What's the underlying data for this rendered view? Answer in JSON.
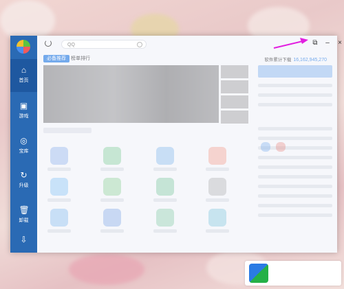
{
  "window": {
    "search_placeholder": "QQ",
    "controls": {
      "restore": "⧉",
      "minimize": "–",
      "close": "×"
    }
  },
  "sidebar": {
    "items": [
      {
        "label": "首页",
        "icon": "home-icon",
        "glyph": "⌂"
      },
      {
        "label": "游戏",
        "icon": "gamepad-icon",
        "glyph": "▣"
      },
      {
        "label": "宝库",
        "icon": "treasure-icon",
        "glyph": "◎"
      },
      {
        "label": "升级",
        "icon": "upgrade-icon",
        "glyph": "↻"
      },
      {
        "label": "卸载",
        "icon": "trash-icon",
        "glyph": "🗑"
      },
      {
        "label": "",
        "icon": "download-icon",
        "glyph": "⇩"
      }
    ]
  },
  "tabs": {
    "active": "必备推荐",
    "second": "榜单排行"
  },
  "stats": {
    "label": "软件累计下载",
    "value": "16,162,945,270"
  },
  "colors": {
    "sidebar": "#2a6ab4",
    "accent": "#2f82e4",
    "annotation_arrow": "#e21fe0"
  }
}
